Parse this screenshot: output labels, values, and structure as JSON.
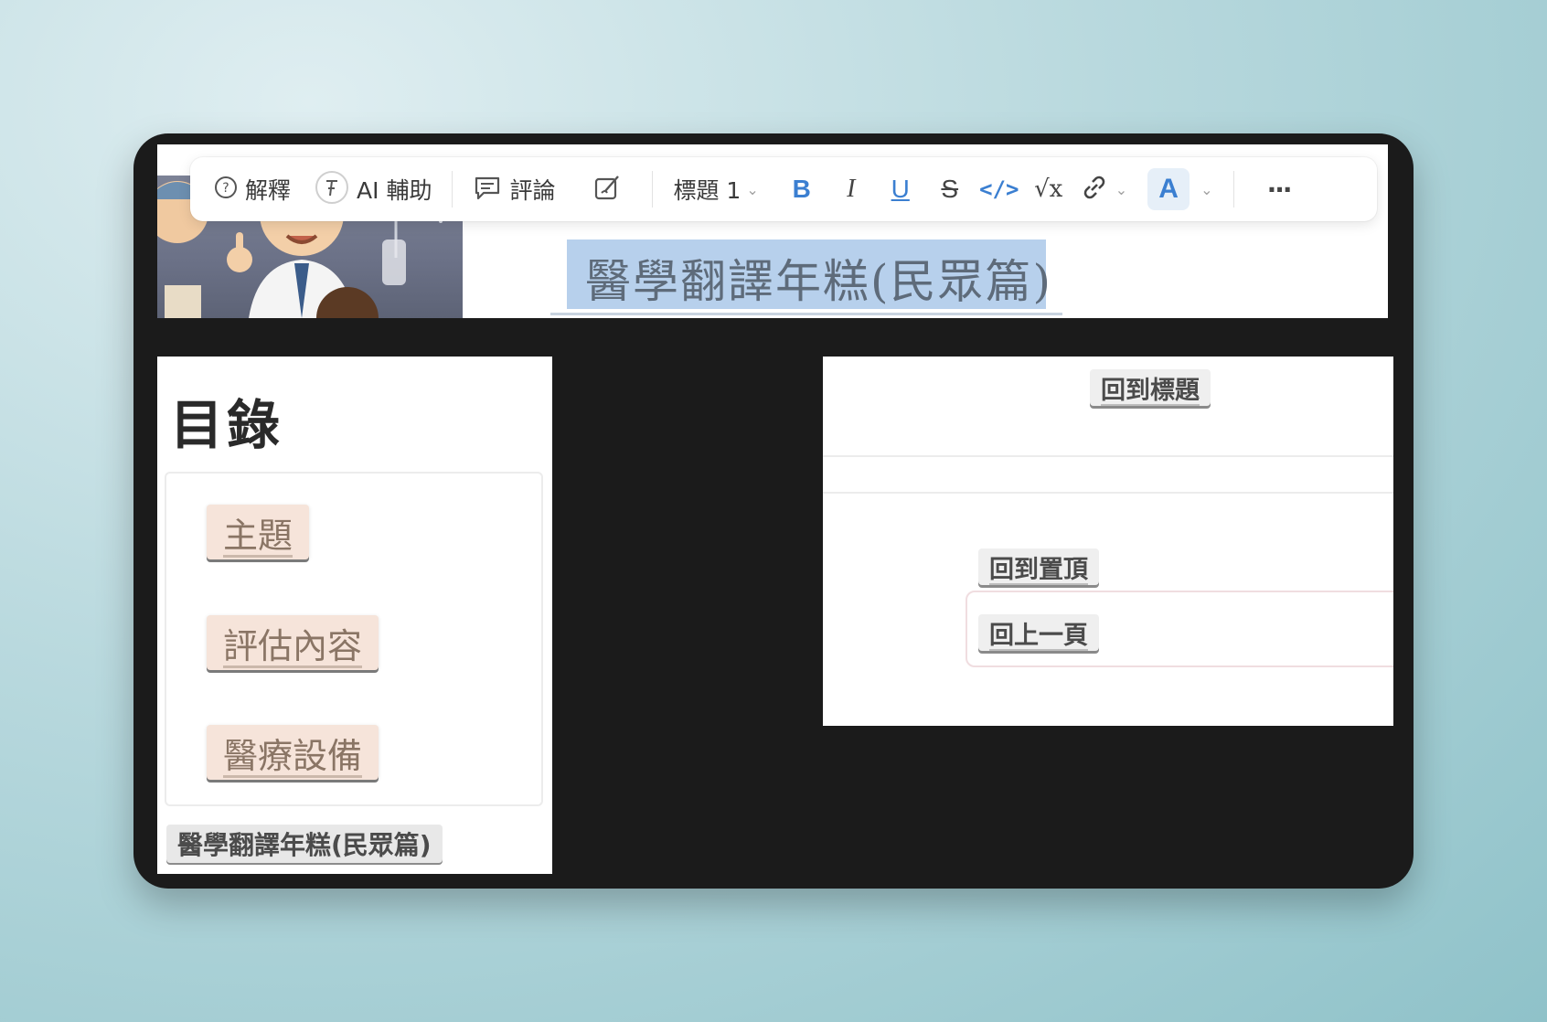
{
  "toolbar": {
    "explain_label": "解釋",
    "ai_label": "AI 輔助",
    "comment_label": "評論",
    "heading_label": "標題 1",
    "bold_label": "B",
    "italic_label": "I",
    "underline_label": "U",
    "strike_label": "S",
    "code_label": "</>",
    "formula_label": "√x",
    "font_color_label": "A",
    "more_label": "···",
    "accent_color": "#3b7fd1"
  },
  "banner": {
    "title": "醫學翻譯年糕(民眾篇)"
  },
  "toc": {
    "heading": "目錄",
    "items": [
      "主題",
      "評估內容",
      "醫療設備"
    ],
    "footer_link": "醫學翻譯年糕(民眾篇)"
  },
  "nav": {
    "back_to_title": "回到標題",
    "back_to_top": "回到置頂",
    "previous_page": "回上一頁"
  }
}
